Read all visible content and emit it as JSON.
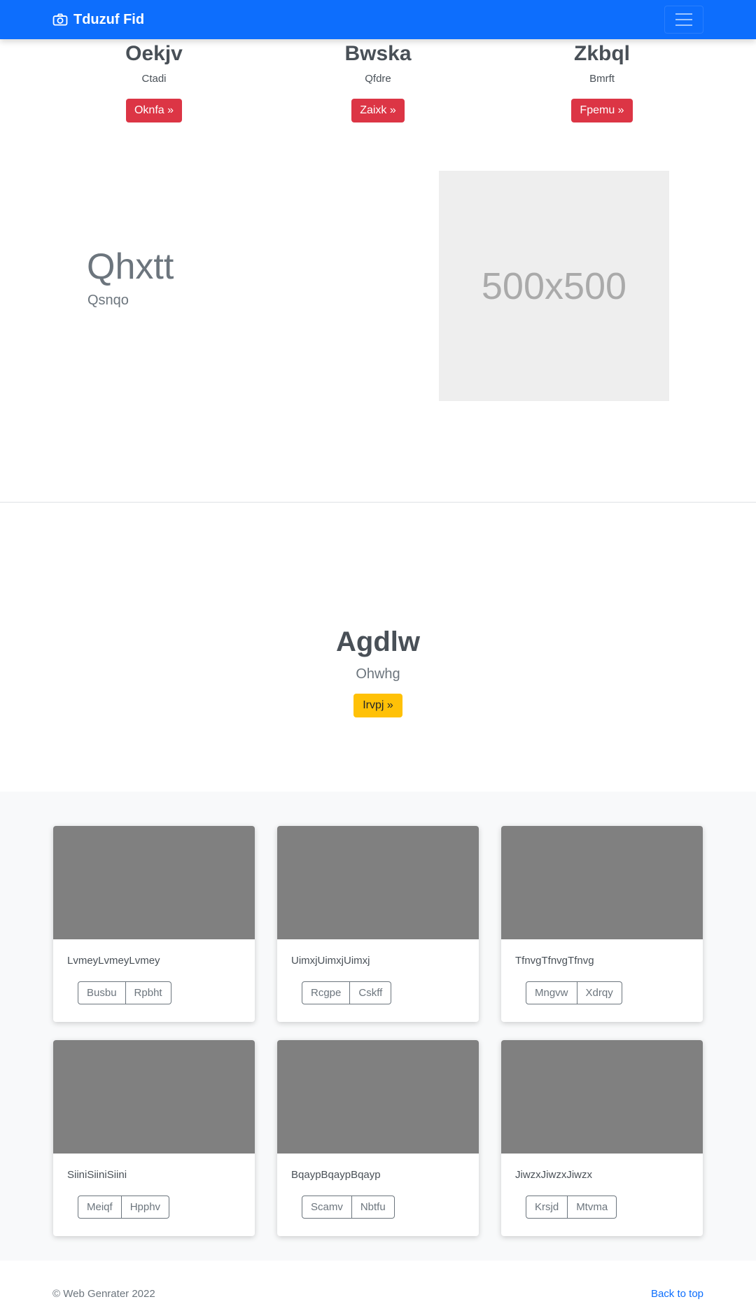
{
  "navbar": {
    "brand": "Tduzuf Fid",
    "icons": {
      "brand": "camera-icon",
      "toggler": "hamburger-menu-icon"
    }
  },
  "features": [
    {
      "title": "Oekjv",
      "text": "Ctadi",
      "button": "Oknfa »"
    },
    {
      "title": "Bwska",
      "text": "Qfdre",
      "button": "Zaixk »"
    },
    {
      "title": "Zkbql",
      "text": "Bmrft",
      "button": "Fpemu »"
    }
  ],
  "hero": {
    "title": "Qhxtt",
    "subtitle": "Qsnqo",
    "image_label": "500x500"
  },
  "cta": {
    "title": "Agdlw",
    "subtitle": "Ohwhg",
    "button": "Irvpj »"
  },
  "cards": [
    {
      "title": "LvmeyLvmeyLvmey",
      "btn1": "Busbu",
      "btn2": "Rpbht"
    },
    {
      "title": "UimxjUimxjUimxj",
      "btn1": "Rcgpe",
      "btn2": "Cskff"
    },
    {
      "title": "TfnvgTfnvgTfnvg",
      "btn1": "Mngvw",
      "btn2": "Xdrqy"
    },
    {
      "title": "SiiniSiiniSiini",
      "btn1": "Meiqf",
      "btn2": "Hpphv"
    },
    {
      "title": "BqaypBqaypBqayp",
      "btn1": "Scamv",
      "btn2": "Nbtfu"
    },
    {
      "title": "JiwzxJiwzxJiwzx",
      "btn1": "Krsjd",
      "btn2": "Mtvma"
    }
  ],
  "footer": {
    "copyright": "© Web Genrater 2022",
    "back_to_top": "Back to top"
  },
  "colors": {
    "primary": "#0d6efd",
    "danger": "#dc3545",
    "warning": "#ffc107",
    "thumb": "#808080"
  }
}
